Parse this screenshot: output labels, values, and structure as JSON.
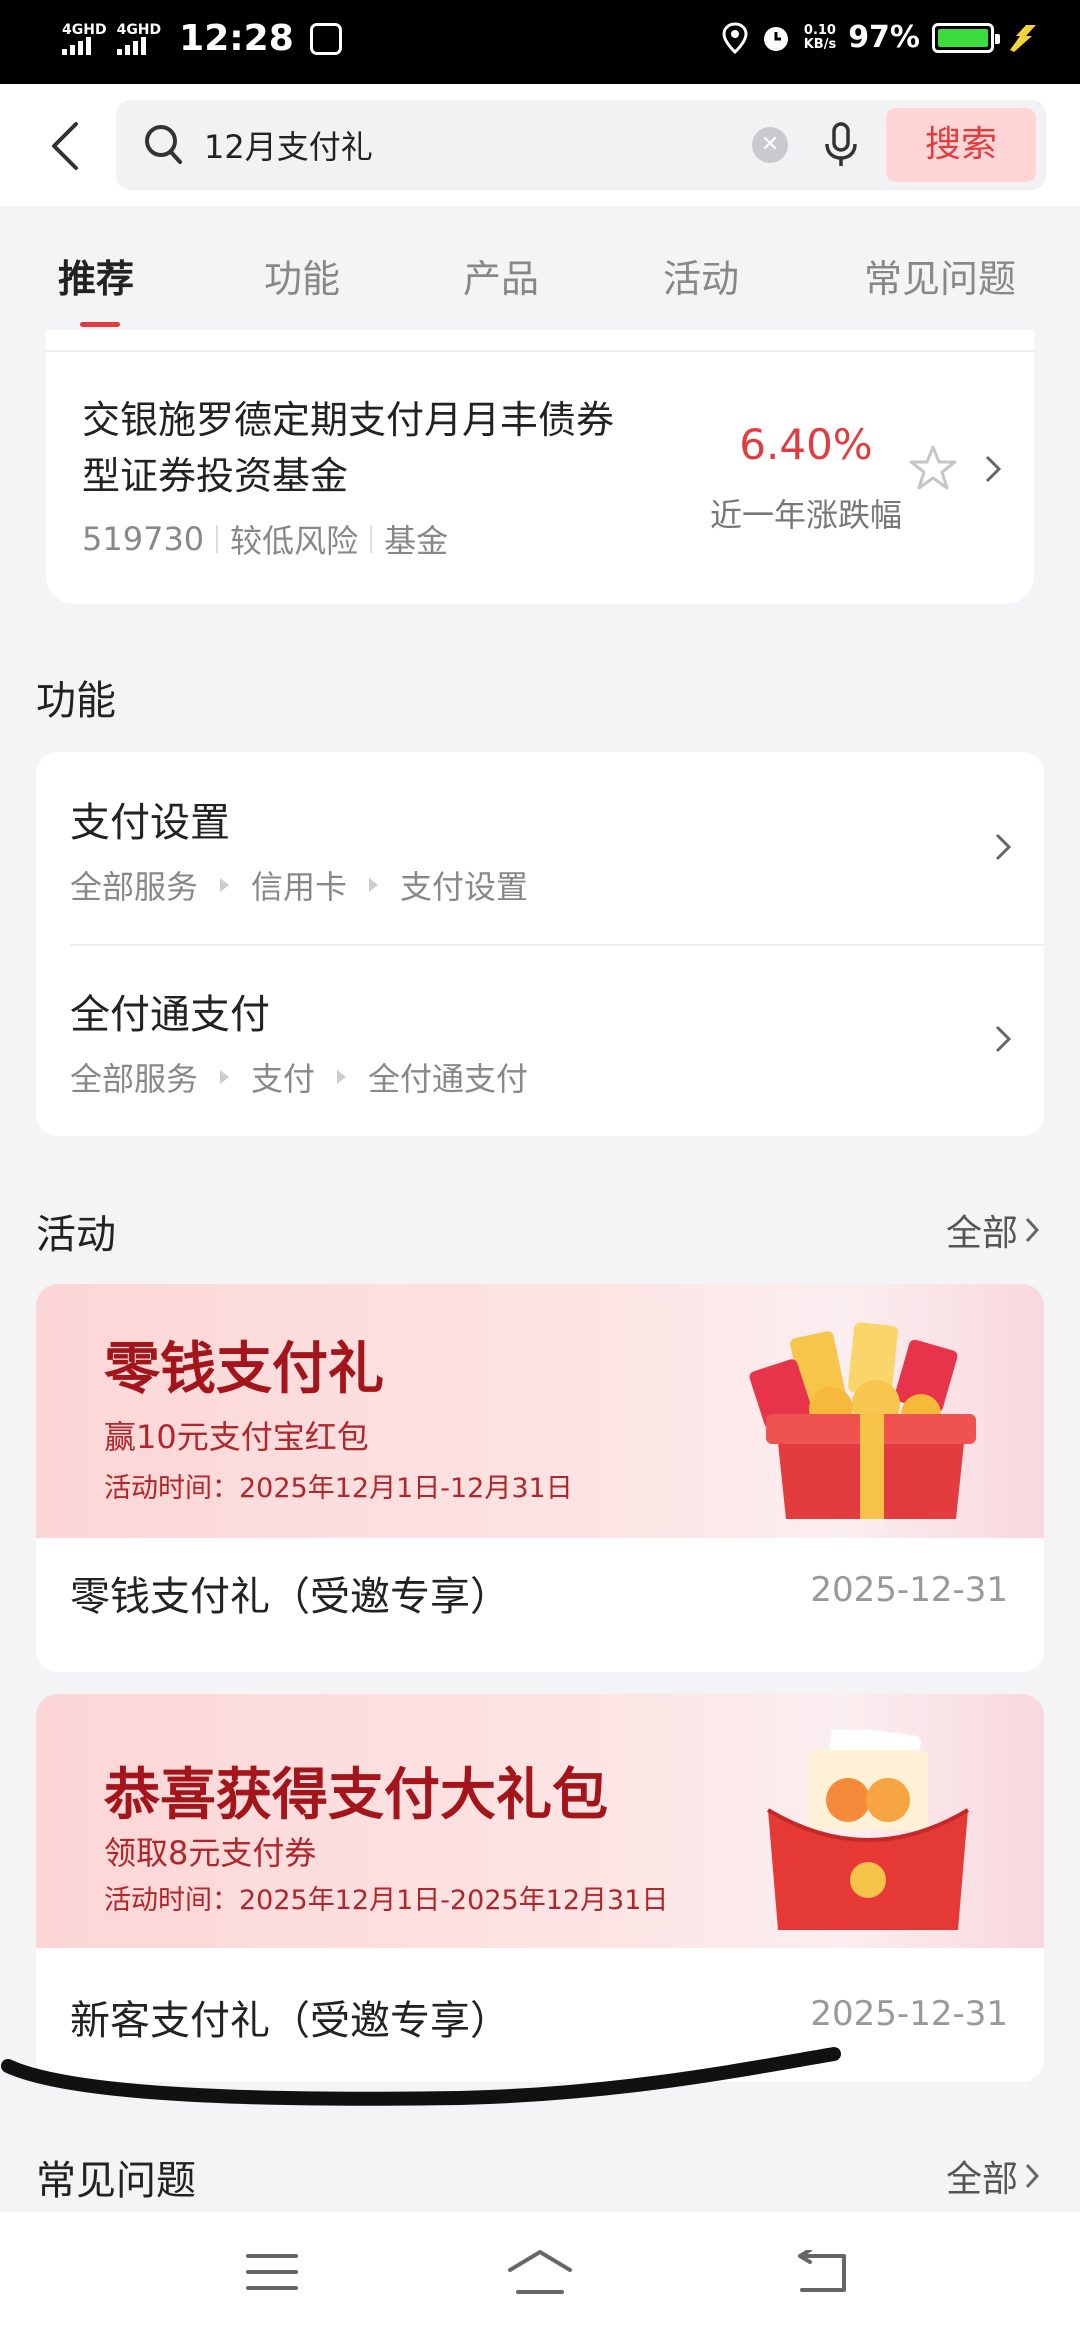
{
  "status_bar": {
    "net1": "4GHD",
    "net2": "4GHD",
    "time": "12:28",
    "speed_value": "0.10",
    "speed_unit": "KB/s",
    "battery": "97%"
  },
  "search": {
    "query": "12月支付礼",
    "button": "搜索"
  },
  "tabs": [
    "推荐",
    "功能",
    "产品",
    "活动",
    "常见问题"
  ],
  "fund": {
    "name": "交银施罗德定期支付月月丰债券型证券投资基金",
    "code": "519730",
    "risk": "较低风险",
    "type": "基金",
    "rate": "6.40%",
    "rate_label": "近一年涨跌幅"
  },
  "functions": {
    "title": "功能",
    "items": [
      {
        "title": "支付设置",
        "path": [
          "全部服务",
          "信用卡",
          "支付设置"
        ]
      },
      {
        "title": "全付通支付",
        "path": [
          "全部服务",
          "支付",
          "全付通支付"
        ]
      }
    ]
  },
  "activities": {
    "title": "活动",
    "all": "全部",
    "items": [
      {
        "banner_title": "零钱支付礼",
        "banner_sub": "赢10元支付宝红包",
        "banner_time": "活动时间：2025年12月1日-12月31日",
        "name": "零钱支付礼（受邀专享）",
        "date": "2025-12-31"
      },
      {
        "banner_title": "恭喜获得支付大礼包",
        "banner_sub": "领取8元支付券",
        "banner_time": "活动时间：2025年12月1日-2025年12月31日",
        "name": "新客支付礼（受邀专享）",
        "date": "2025-12-31"
      }
    ]
  },
  "faq": {
    "title": "常见问题",
    "all": "全部"
  },
  "colors": {
    "accent": "#e23c3f",
    "banner_text": "#a3151b",
    "page_bg": "#f4f4f6"
  }
}
